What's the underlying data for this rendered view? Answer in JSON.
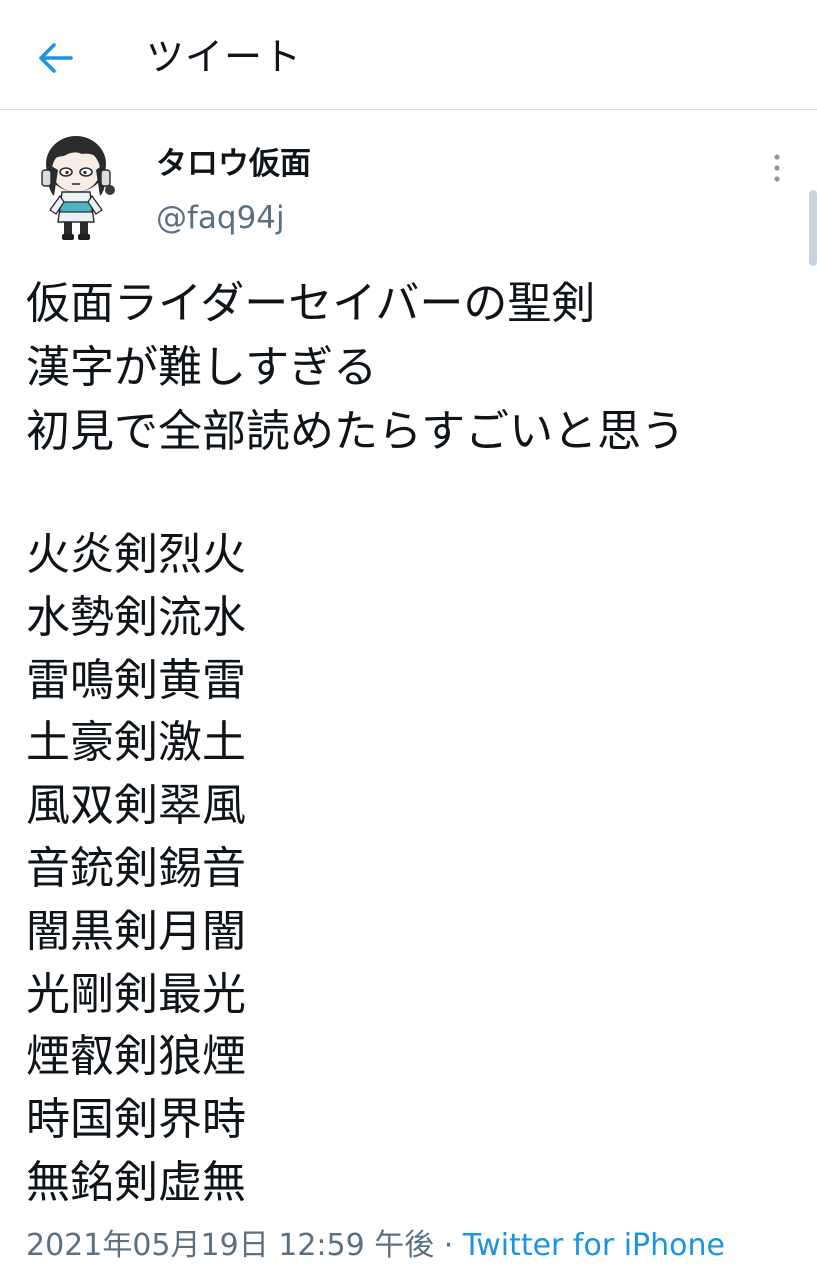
{
  "header": {
    "title": "ツイート",
    "back_icon": "arrow-left-icon"
  },
  "colors": {
    "accent": "#1b95e0",
    "secondary_text": "#5b7083",
    "primary_text": "#0f1419"
  },
  "author": {
    "display_name": "タロウ仮面",
    "handle": "@faq94j",
    "avatar_icon": "cartoon-avatar"
  },
  "tweet": {
    "lines": [
      "仮面ライダーセイバーの聖剣",
      "漢字が難しすぎる",
      "初見で全部読めたらすごいと思う"
    ],
    "swords": [
      "火炎剣烈火",
      "水勢剣流水",
      "雷鳴剣黄雷",
      "土豪剣激土",
      "風双剣翠風",
      "音銃剣錫音",
      "闇黒剣月闇",
      "光剛剣最光",
      "煙叡剣狼煙",
      "時国剣界時",
      "無銘剣虚無"
    ]
  },
  "meta": {
    "timestamp": "2021年05月19日 12:59 午後",
    "separator": " · ",
    "client": "Twitter for iPhone"
  }
}
